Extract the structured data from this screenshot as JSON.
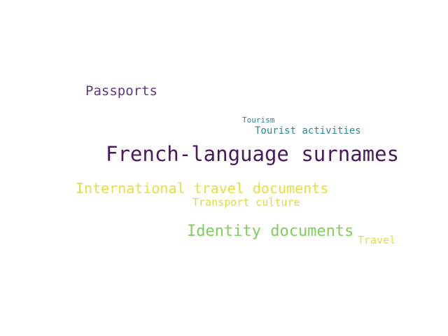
{
  "word_cloud": {
    "words": [
      {
        "id": "passports",
        "text": "Passports",
        "color": "#5b3a7a"
      },
      {
        "id": "tourism",
        "text": "Tourism",
        "color": "#2e7f8f"
      },
      {
        "id": "tourist_activities",
        "text": "Tourist activities",
        "color": "#2a8a8f"
      },
      {
        "id": "french_language_surnames",
        "text": "French-language surnames",
        "color": "#4a1760"
      },
      {
        "id": "international_travel_documents",
        "text": "International travel documents",
        "color": "#e6e13b"
      },
      {
        "id": "transport_culture",
        "text": "Transport culture",
        "color": "#dcdc3a"
      },
      {
        "id": "identity_documents",
        "text": "Identity documents",
        "color": "#7fcf5a"
      },
      {
        "id": "travel",
        "text": "Travel",
        "color": "#e3dc45"
      }
    ]
  }
}
